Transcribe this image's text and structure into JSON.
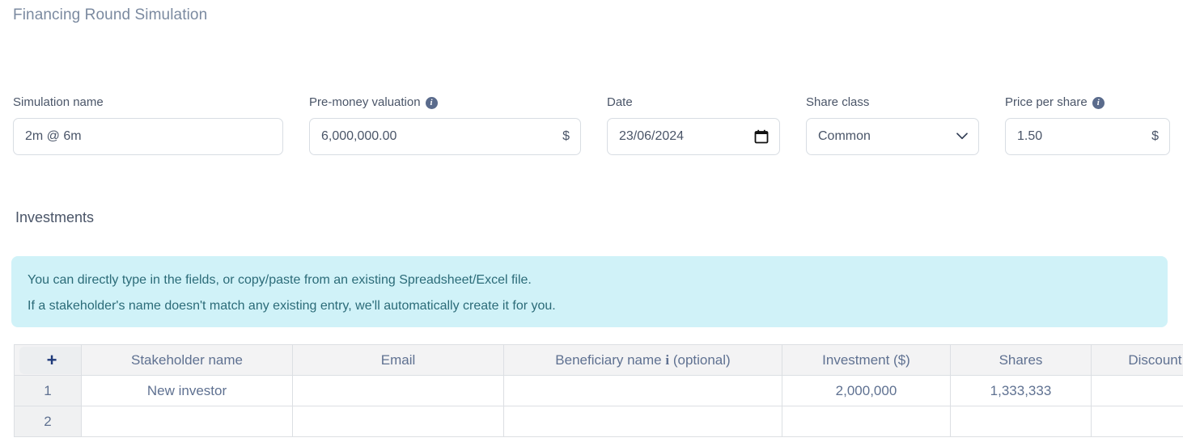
{
  "page": {
    "title": "Financing Round Simulation",
    "section_title": "Investments"
  },
  "form": {
    "simulation_name": {
      "label": "Simulation name",
      "value": "2m @ 6m"
    },
    "pre_money_valuation": {
      "label": "Pre-money valuation",
      "value": "6,000,000.00",
      "suffix": "$",
      "info_icon": "info-icon",
      "info_glyph": "i"
    },
    "date": {
      "label": "Date",
      "value": "23/06/2024",
      "icon": "calendar-icon"
    },
    "share_class": {
      "label": "Share class",
      "value": "Common",
      "options": [
        "Common"
      ],
      "icon": "chevron-down-icon"
    },
    "price_per_share": {
      "label": "Price per share",
      "value": "1.50",
      "suffix": "$",
      "info_icon": "info-icon",
      "info_glyph": "i"
    }
  },
  "banner": {
    "line1": "You can directly type in the fields, or copy/paste from an existing Spreadsheet/Excel file.",
    "line2": "If a stakeholder's name doesn't match any existing entry, we'll automatically create it for you.",
    "background": "#d0f2f8",
    "text_color": "#2b6b78"
  },
  "table": {
    "add_row_button": "+",
    "headers": {
      "stakeholder_name": "Stakeholder name",
      "email": "Email",
      "beneficiary_name_pre": "Beneficiary name",
      "beneficiary_name_i": "i",
      "beneficiary_name_post": "(optional)",
      "investment": "Investment ($)",
      "shares": "Shares",
      "discount": "Discount (%)"
    },
    "rows": [
      {
        "num": "1",
        "stakeholder_name": "New investor",
        "email": "",
        "beneficiary_name": "",
        "investment": "2,000,000",
        "shares": "1,333,333",
        "discount": ""
      },
      {
        "num": "2",
        "stakeholder_name": "",
        "email": "",
        "beneficiary_name": "",
        "investment": "",
        "shares": "",
        "discount": ""
      }
    ]
  }
}
